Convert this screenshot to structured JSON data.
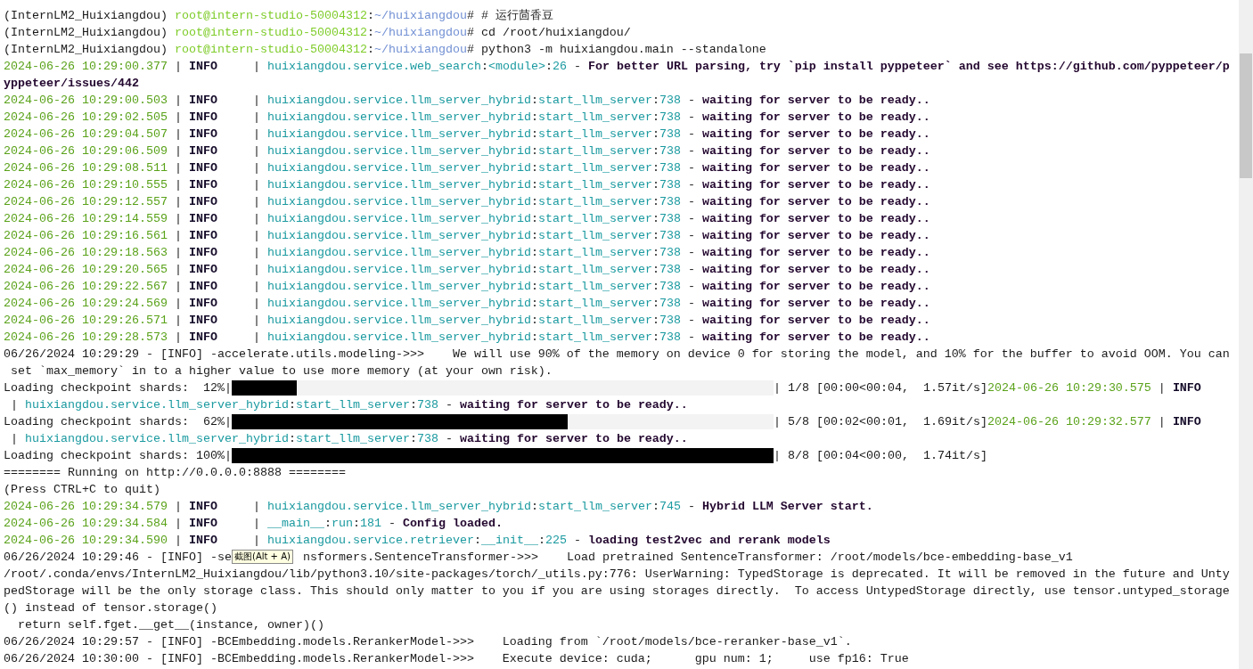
{
  "terminal": {
    "lines": [
      [
        {
          "kind": "t",
          "text": "(InternLM2_Huixiangdou) "
        },
        {
          "kind": "user",
          "text": "root@intern-studio-50004312"
        },
        {
          "kind": "t",
          "text": ":"
        },
        {
          "kind": "path",
          "text": "~/huixiangdou"
        },
        {
          "kind": "t",
          "text": "# # 运行茴香豆"
        }
      ],
      [
        {
          "kind": "t",
          "text": "(InternLM2_Huixiangdou) "
        },
        {
          "kind": "user",
          "text": "root@intern-studio-50004312"
        },
        {
          "kind": "t",
          "text": ":"
        },
        {
          "kind": "path",
          "text": "~/huixiangdou"
        },
        {
          "kind": "t",
          "text": "# cd /root/huixiangdou/"
        }
      ],
      [
        {
          "kind": "t",
          "text": "(InternLM2_Huixiangdou) "
        },
        {
          "kind": "user",
          "text": "root@intern-studio-50004312"
        },
        {
          "kind": "t",
          "text": ":"
        },
        {
          "kind": "path",
          "text": "~/huixiangdou"
        },
        {
          "kind": "t",
          "text": "# python3 -m huixiangdou.main --standalone"
        }
      ],
      [
        {
          "kind": "ts",
          "text": "2024-06-26 10:29:00.377"
        },
        {
          "kind": "t",
          "text": " | "
        },
        {
          "kind": "lvl",
          "text": "INFO"
        },
        {
          "kind": "t",
          "text": "     | "
        },
        {
          "kind": "mod",
          "text": "huixiangdou.service.web_search"
        },
        {
          "kind": "t",
          "text": ":"
        },
        {
          "kind": "mod",
          "text": "<module>"
        },
        {
          "kind": "t",
          "text": ":"
        },
        {
          "kind": "mod",
          "text": "26"
        },
        {
          "kind": "t",
          "text": " - "
        },
        {
          "kind": "msg",
          "text": "For better URL parsing, try `pip install pyppeteer` and see https://github.com/pyppeteer/p"
        }
      ],
      [
        {
          "kind": "msg",
          "text": "yppeteer/issues/442"
        }
      ],
      [
        {
          "kind": "ts",
          "text": "2024-06-26 10:29:00.503"
        },
        {
          "kind": "t",
          "text": " | "
        },
        {
          "kind": "lvl",
          "text": "INFO"
        },
        {
          "kind": "t",
          "text": "     | "
        },
        {
          "kind": "mod",
          "text": "huixiangdou.service.llm_server_hybrid"
        },
        {
          "kind": "t",
          "text": ":"
        },
        {
          "kind": "mod",
          "text": "start_llm_server"
        },
        {
          "kind": "t",
          "text": ":"
        },
        {
          "kind": "mod",
          "text": "738"
        },
        {
          "kind": "t",
          "text": " - "
        },
        {
          "kind": "msg",
          "text": "waiting for server to be ready.."
        }
      ],
      [
        {
          "kind": "ts",
          "text": "2024-06-26 10:29:02.505"
        },
        {
          "kind": "t",
          "text": " | "
        },
        {
          "kind": "lvl",
          "text": "INFO"
        },
        {
          "kind": "t",
          "text": "     | "
        },
        {
          "kind": "mod",
          "text": "huixiangdou.service.llm_server_hybrid"
        },
        {
          "kind": "t",
          "text": ":"
        },
        {
          "kind": "mod",
          "text": "start_llm_server"
        },
        {
          "kind": "t",
          "text": ":"
        },
        {
          "kind": "mod",
          "text": "738"
        },
        {
          "kind": "t",
          "text": " - "
        },
        {
          "kind": "msg",
          "text": "waiting for server to be ready.."
        }
      ],
      [
        {
          "kind": "ts",
          "text": "2024-06-26 10:29:04.507"
        },
        {
          "kind": "t",
          "text": " | "
        },
        {
          "kind": "lvl",
          "text": "INFO"
        },
        {
          "kind": "t",
          "text": "     | "
        },
        {
          "kind": "mod",
          "text": "huixiangdou.service.llm_server_hybrid"
        },
        {
          "kind": "t",
          "text": ":"
        },
        {
          "kind": "mod",
          "text": "start_llm_server"
        },
        {
          "kind": "t",
          "text": ":"
        },
        {
          "kind": "mod",
          "text": "738"
        },
        {
          "kind": "t",
          "text": " - "
        },
        {
          "kind": "msg",
          "text": "waiting for server to be ready.."
        }
      ],
      [
        {
          "kind": "ts",
          "text": "2024-06-26 10:29:06.509"
        },
        {
          "kind": "t",
          "text": " | "
        },
        {
          "kind": "lvl",
          "text": "INFO"
        },
        {
          "kind": "t",
          "text": "     | "
        },
        {
          "kind": "mod",
          "text": "huixiangdou.service.llm_server_hybrid"
        },
        {
          "kind": "t",
          "text": ":"
        },
        {
          "kind": "mod",
          "text": "start_llm_server"
        },
        {
          "kind": "t",
          "text": ":"
        },
        {
          "kind": "mod",
          "text": "738"
        },
        {
          "kind": "t",
          "text": " - "
        },
        {
          "kind": "msg",
          "text": "waiting for server to be ready.."
        }
      ],
      [
        {
          "kind": "ts",
          "text": "2024-06-26 10:29:08.511"
        },
        {
          "kind": "t",
          "text": " | "
        },
        {
          "kind": "lvl",
          "text": "INFO"
        },
        {
          "kind": "t",
          "text": "     | "
        },
        {
          "kind": "mod",
          "text": "huixiangdou.service.llm_server_hybrid"
        },
        {
          "kind": "t",
          "text": ":"
        },
        {
          "kind": "mod",
          "text": "start_llm_server"
        },
        {
          "kind": "t",
          "text": ":"
        },
        {
          "kind": "mod",
          "text": "738"
        },
        {
          "kind": "t",
          "text": " - "
        },
        {
          "kind": "msg",
          "text": "waiting for server to be ready.."
        }
      ],
      [
        {
          "kind": "ts",
          "text": "2024-06-26 10:29:10.555"
        },
        {
          "kind": "t",
          "text": " | "
        },
        {
          "kind": "lvl",
          "text": "INFO"
        },
        {
          "kind": "t",
          "text": "     | "
        },
        {
          "kind": "mod",
          "text": "huixiangdou.service.llm_server_hybrid"
        },
        {
          "kind": "t",
          "text": ":"
        },
        {
          "kind": "mod",
          "text": "start_llm_server"
        },
        {
          "kind": "t",
          "text": ":"
        },
        {
          "kind": "mod",
          "text": "738"
        },
        {
          "kind": "t",
          "text": " - "
        },
        {
          "kind": "msg",
          "text": "waiting for server to be ready.."
        }
      ],
      [
        {
          "kind": "ts",
          "text": "2024-06-26 10:29:12.557"
        },
        {
          "kind": "t",
          "text": " | "
        },
        {
          "kind": "lvl",
          "text": "INFO"
        },
        {
          "kind": "t",
          "text": "     | "
        },
        {
          "kind": "mod",
          "text": "huixiangdou.service.llm_server_hybrid"
        },
        {
          "kind": "t",
          "text": ":"
        },
        {
          "kind": "mod",
          "text": "start_llm_server"
        },
        {
          "kind": "t",
          "text": ":"
        },
        {
          "kind": "mod",
          "text": "738"
        },
        {
          "kind": "t",
          "text": " - "
        },
        {
          "kind": "msg",
          "text": "waiting for server to be ready.."
        }
      ],
      [
        {
          "kind": "ts",
          "text": "2024-06-26 10:29:14.559"
        },
        {
          "kind": "t",
          "text": " | "
        },
        {
          "kind": "lvl",
          "text": "INFO"
        },
        {
          "kind": "t",
          "text": "     | "
        },
        {
          "kind": "mod",
          "text": "huixiangdou.service.llm_server_hybrid"
        },
        {
          "kind": "t",
          "text": ":"
        },
        {
          "kind": "mod",
          "text": "start_llm_server"
        },
        {
          "kind": "t",
          "text": ":"
        },
        {
          "kind": "mod",
          "text": "738"
        },
        {
          "kind": "t",
          "text": " - "
        },
        {
          "kind": "msg",
          "text": "waiting for server to be ready.."
        }
      ],
      [
        {
          "kind": "ts",
          "text": "2024-06-26 10:29:16.561"
        },
        {
          "kind": "t",
          "text": " | "
        },
        {
          "kind": "lvl",
          "text": "INFO"
        },
        {
          "kind": "t",
          "text": "     | "
        },
        {
          "kind": "mod",
          "text": "huixiangdou.service.llm_server_hybrid"
        },
        {
          "kind": "t",
          "text": ":"
        },
        {
          "kind": "mod",
          "text": "start_llm_server"
        },
        {
          "kind": "t",
          "text": ":"
        },
        {
          "kind": "mod",
          "text": "738"
        },
        {
          "kind": "t",
          "text": " - "
        },
        {
          "kind": "msg",
          "text": "waiting for server to be ready.."
        }
      ],
      [
        {
          "kind": "ts",
          "text": "2024-06-26 10:29:18.563"
        },
        {
          "kind": "t",
          "text": " | "
        },
        {
          "kind": "lvl",
          "text": "INFO"
        },
        {
          "kind": "t",
          "text": "     | "
        },
        {
          "kind": "mod",
          "text": "huixiangdou.service.llm_server_hybrid"
        },
        {
          "kind": "t",
          "text": ":"
        },
        {
          "kind": "mod",
          "text": "start_llm_server"
        },
        {
          "kind": "t",
          "text": ":"
        },
        {
          "kind": "mod",
          "text": "738"
        },
        {
          "kind": "t",
          "text": " - "
        },
        {
          "kind": "msg",
          "text": "waiting for server to be ready.."
        }
      ],
      [
        {
          "kind": "ts",
          "text": "2024-06-26 10:29:20.565"
        },
        {
          "kind": "t",
          "text": " | "
        },
        {
          "kind": "lvl",
          "text": "INFO"
        },
        {
          "kind": "t",
          "text": "     | "
        },
        {
          "kind": "mod",
          "text": "huixiangdou.service.llm_server_hybrid"
        },
        {
          "kind": "t",
          "text": ":"
        },
        {
          "kind": "mod",
          "text": "start_llm_server"
        },
        {
          "kind": "t",
          "text": ":"
        },
        {
          "kind": "mod",
          "text": "738"
        },
        {
          "kind": "t",
          "text": " - "
        },
        {
          "kind": "msg",
          "text": "waiting for server to be ready.."
        }
      ],
      [
        {
          "kind": "ts",
          "text": "2024-06-26 10:29:22.567"
        },
        {
          "kind": "t",
          "text": " | "
        },
        {
          "kind": "lvl",
          "text": "INFO"
        },
        {
          "kind": "t",
          "text": "     | "
        },
        {
          "kind": "mod",
          "text": "huixiangdou.service.llm_server_hybrid"
        },
        {
          "kind": "t",
          "text": ":"
        },
        {
          "kind": "mod",
          "text": "start_llm_server"
        },
        {
          "kind": "t",
          "text": ":"
        },
        {
          "kind": "mod",
          "text": "738"
        },
        {
          "kind": "t",
          "text": " - "
        },
        {
          "kind": "msg",
          "text": "waiting for server to be ready.."
        }
      ],
      [
        {
          "kind": "ts",
          "text": "2024-06-26 10:29:24.569"
        },
        {
          "kind": "t",
          "text": " | "
        },
        {
          "kind": "lvl",
          "text": "INFO"
        },
        {
          "kind": "t",
          "text": "     | "
        },
        {
          "kind": "mod",
          "text": "huixiangdou.service.llm_server_hybrid"
        },
        {
          "kind": "t",
          "text": ":"
        },
        {
          "kind": "mod",
          "text": "start_llm_server"
        },
        {
          "kind": "t",
          "text": ":"
        },
        {
          "kind": "mod",
          "text": "738"
        },
        {
          "kind": "t",
          "text": " - "
        },
        {
          "kind": "msg",
          "text": "waiting for server to be ready.."
        }
      ],
      [
        {
          "kind": "ts",
          "text": "2024-06-26 10:29:26.571"
        },
        {
          "kind": "t",
          "text": " | "
        },
        {
          "kind": "lvl",
          "text": "INFO"
        },
        {
          "kind": "t",
          "text": "     | "
        },
        {
          "kind": "mod",
          "text": "huixiangdou.service.llm_server_hybrid"
        },
        {
          "kind": "t",
          "text": ":"
        },
        {
          "kind": "mod",
          "text": "start_llm_server"
        },
        {
          "kind": "t",
          "text": ":"
        },
        {
          "kind": "mod",
          "text": "738"
        },
        {
          "kind": "t",
          "text": " - "
        },
        {
          "kind": "msg",
          "text": "waiting for server to be ready.."
        }
      ],
      [
        {
          "kind": "ts",
          "text": "2024-06-26 10:29:28.573"
        },
        {
          "kind": "t",
          "text": " | "
        },
        {
          "kind": "lvl",
          "text": "INFO"
        },
        {
          "kind": "t",
          "text": "     | "
        },
        {
          "kind": "mod",
          "text": "huixiangdou.service.llm_server_hybrid"
        },
        {
          "kind": "t",
          "text": ":"
        },
        {
          "kind": "mod",
          "text": "start_llm_server"
        },
        {
          "kind": "t",
          "text": ":"
        },
        {
          "kind": "mod",
          "text": "738"
        },
        {
          "kind": "t",
          "text": " - "
        },
        {
          "kind": "msg",
          "text": "waiting for server to be ready.."
        }
      ],
      [
        {
          "kind": "t",
          "text": "06/26/2024 10:29:29 - [INFO] -accelerate.utils.modeling->>>    We will use 90% of the memory on device 0 for storing the model, and 10% for the buffer to avoid OOM. You can"
        }
      ],
      [
        {
          "kind": "t",
          "text": " set `max_memory` in to a higher value to use more memory (at your own risk)."
        }
      ],
      [
        {
          "kind": "t",
          "text": "Loading checkpoint shards:  12%|"
        },
        {
          "kind": "bar",
          "level": 0.12
        },
        {
          "kind": "t",
          "text": "| 1/8 [00:00<00:04,  1.57it/s]"
        },
        {
          "kind": "ts",
          "text": "2024-06-26 10:29:30.575"
        },
        {
          "kind": "t",
          "text": " | "
        },
        {
          "kind": "lvl",
          "text": "INFO"
        }
      ],
      [
        {
          "kind": "t",
          "text": " | "
        },
        {
          "kind": "mod",
          "text": "huixiangdou.service.llm_server_hybrid"
        },
        {
          "kind": "t",
          "text": ":"
        },
        {
          "kind": "mod",
          "text": "start_llm_server"
        },
        {
          "kind": "t",
          "text": ":"
        },
        {
          "kind": "mod",
          "text": "738"
        },
        {
          "kind": "t",
          "text": " - "
        },
        {
          "kind": "msg",
          "text": "waiting for server to be ready.."
        }
      ],
      [
        {
          "kind": "t",
          "text": "Loading checkpoint shards:  62%|"
        },
        {
          "kind": "bar",
          "level": 0.62
        },
        {
          "kind": "t",
          "text": "| 5/8 [00:02<00:01,  1.69it/s]"
        },
        {
          "kind": "ts",
          "text": "2024-06-26 10:29:32.577"
        },
        {
          "kind": "t",
          "text": " | "
        },
        {
          "kind": "lvl",
          "text": "INFO"
        }
      ],
      [
        {
          "kind": "t",
          "text": " | "
        },
        {
          "kind": "mod",
          "text": "huixiangdou.service.llm_server_hybrid"
        },
        {
          "kind": "t",
          "text": ":"
        },
        {
          "kind": "mod",
          "text": "start_llm_server"
        },
        {
          "kind": "t",
          "text": ":"
        },
        {
          "kind": "mod",
          "text": "738"
        },
        {
          "kind": "t",
          "text": " - "
        },
        {
          "kind": "msg",
          "text": "waiting for server to be ready.."
        }
      ],
      [
        {
          "kind": "t",
          "text": "Loading checkpoint shards: 100%|"
        },
        {
          "kind": "bar",
          "level": 1
        },
        {
          "kind": "t",
          "text": "| 8/8 [00:04<00:00,  1.74it/s]"
        }
      ],
      [
        {
          "kind": "t",
          "text": "======== Running on http://0.0.0.0:8888 ========"
        }
      ],
      [
        {
          "kind": "t",
          "text": "(Press CTRL+C to quit)"
        }
      ],
      [
        {
          "kind": "ts",
          "text": "2024-06-26 10:29:34.579"
        },
        {
          "kind": "t",
          "text": " | "
        },
        {
          "kind": "lvl",
          "text": "INFO"
        },
        {
          "kind": "t",
          "text": "     | "
        },
        {
          "kind": "mod",
          "text": "huixiangdou.service.llm_server_hybrid"
        },
        {
          "kind": "t",
          "text": ":"
        },
        {
          "kind": "mod",
          "text": "start_llm_server"
        },
        {
          "kind": "t",
          "text": ":"
        },
        {
          "kind": "mod",
          "text": "745"
        },
        {
          "kind": "t",
          "text": " - "
        },
        {
          "kind": "msg",
          "text": "Hybrid LLM Server start."
        }
      ],
      [
        {
          "kind": "ts",
          "text": "2024-06-26 10:29:34.584"
        },
        {
          "kind": "t",
          "text": " | "
        },
        {
          "kind": "lvl",
          "text": "INFO"
        },
        {
          "kind": "t",
          "text": "     | "
        },
        {
          "kind": "mod",
          "text": "__main__"
        },
        {
          "kind": "t",
          "text": ":"
        },
        {
          "kind": "mod",
          "text": "run"
        },
        {
          "kind": "t",
          "text": ":"
        },
        {
          "kind": "mod",
          "text": "181"
        },
        {
          "kind": "t",
          "text": " - "
        },
        {
          "kind": "msg",
          "text": "Config loaded."
        }
      ],
      [
        {
          "kind": "ts",
          "text": "2024-06-26 10:29:34.590"
        },
        {
          "kind": "t",
          "text": " | "
        },
        {
          "kind": "lvl",
          "text": "INFO"
        },
        {
          "kind": "t",
          "text": "     | "
        },
        {
          "kind": "mod",
          "text": "huixiangdou.service.retriever"
        },
        {
          "kind": "t",
          "text": ":"
        },
        {
          "kind": "mod",
          "text": "__init__"
        },
        {
          "kind": "t",
          "text": ":"
        },
        {
          "kind": "mod",
          "text": "225"
        },
        {
          "kind": "t",
          "text": " - "
        },
        {
          "kind": "msg",
          "text": "loading test2vec and rerank models"
        }
      ],
      [
        {
          "kind": "t",
          "text": "06/26/2024 10:29:46 - [INFO] -se"
        },
        {
          "kind": "gap"
        },
        {
          "kind": "t",
          "text": "nsformers.SentenceTransformer->>>    Load pretrained SentenceTransformer: /root/models/bce-embedding-base_v1"
        }
      ],
      [
        {
          "kind": "t",
          "text": "/root/.conda/envs/InternLM2_Huixiangdou/lib/python3.10/site-packages/torch/_utils.py:776: UserWarning: TypedStorage is deprecated. It will be removed in the future and Unty"
        }
      ],
      [
        {
          "kind": "t",
          "text": "pedStorage will be the only storage class. This should only matter to you if you are using storages directly.  To access UntypedStorage directly, use tensor.untyped_storage"
        }
      ],
      [
        {
          "kind": "t",
          "text": "() instead of tensor.storage()"
        }
      ],
      [
        {
          "kind": "t",
          "text": "  return self.fget.__get__(instance, owner)()"
        }
      ],
      [
        {
          "kind": "t",
          "text": "06/26/2024 10:29:57 - [INFO] -BCEmbedding.models.RerankerModel->>>    Loading from `/root/models/bce-reranker-base_v1`."
        }
      ],
      [
        {
          "kind": "t",
          "text": "06/26/2024 10:30:00 - [INFO] -BCEmbedding.models.RerankerModel->>>    Execute device: cuda;      gpu num: 1;     use fp16: True"
        }
      ]
    ]
  },
  "tooltip": {
    "text": "截图(Alt + A)"
  }
}
